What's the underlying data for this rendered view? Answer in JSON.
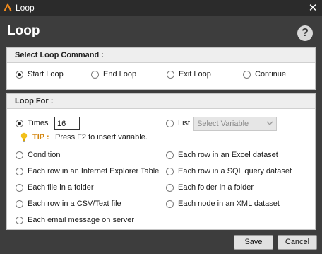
{
  "window": {
    "title": "Loop",
    "close_glyph": "✕",
    "logo_icon": "app-logo-icon"
  },
  "header": {
    "title": "Loop",
    "help_label": "?"
  },
  "command_section": {
    "title": "Select Loop Command :",
    "options": [
      {
        "label": "Start Loop",
        "checked": true
      },
      {
        "label": "End Loop",
        "checked": false
      },
      {
        "label": "Exit Loop",
        "checked": false
      },
      {
        "label": "Continue",
        "checked": false
      }
    ]
  },
  "loop_for_section": {
    "title": "Loop For :",
    "times_label": "Times",
    "times_value": "16",
    "list_label": "List",
    "list_select_value": "Select Variable",
    "tip_label": "TIP :",
    "tip_text": "Press F2 to insert variable.",
    "options_left": [
      "Condition",
      "Each row in an Internet Explorer Table",
      "Each file in a folder",
      "Each row in a CSV/Text file",
      "Each email message on server"
    ],
    "options_right": [
      "Each row in an Excel dataset",
      "Each row in a SQL query dataset",
      "Each folder in a folder",
      "Each node in an XML dataset"
    ],
    "selected": "Times"
  },
  "footer": {
    "save_label": "Save",
    "cancel_label": "Cancel"
  },
  "colors": {
    "dialog_background": "#3d3d3d",
    "titlebar_background": "#2b2b2b",
    "tip_accent": "#d4860f"
  }
}
